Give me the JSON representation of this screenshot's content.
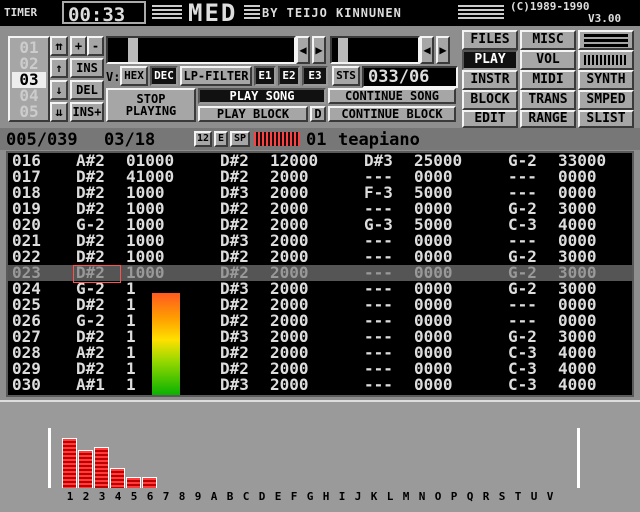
{
  "topbar": {
    "timer_label": "TIMER",
    "timer_value": "00:33",
    "logo": "MED",
    "author": "BY TEIJO KINNUNEN",
    "copyright": "(C)1989-1990",
    "version": "V3.00"
  },
  "tracks": {
    "numbers": [
      "01",
      "02",
      "03",
      "04",
      "05"
    ],
    "current": "03"
  },
  "side_buttons": {
    "ins": "INS",
    "del": "DEL",
    "ins_plus": "INS+",
    "plus": "+",
    "minus": "-"
  },
  "mode": {
    "v_label": "V:",
    "hex": "HEX",
    "dec": "DEC",
    "filter": "LP-FILTER",
    "e1": "E1",
    "e2": "E2",
    "e3": "E3",
    "sts": "STS",
    "sts_value": "033/06"
  },
  "play": {
    "stop": "STOP",
    "playing": "PLAYING",
    "play_song": "PLAY SONG",
    "play_block": "PLAY BLOCK",
    "d": "D",
    "continue_song": "CONTINUE SONG",
    "continue_block": "CONTINUE BLOCK"
  },
  "menu": {
    "files": "FILES",
    "misc": "MISC",
    "play": "PLAY",
    "vol": "VOL",
    "instr": "INSTR",
    "midi": "MIDI",
    "synth": "SYNTH",
    "block": "BLOCK",
    "trans": "TRANS",
    "smped": "SMPED",
    "edit": "EDIT",
    "range": "RANGE",
    "slist": "SLIST"
  },
  "status": {
    "block": "005/039",
    "position": "03/18",
    "num12": "12",
    "e": "E",
    "sp": "SP",
    "instr_num": "01",
    "instr_name": "teapiano"
  },
  "pattern_rows": [
    {
      "line": "016",
      "c1": "A#2",
      "v1": "01000",
      "c2": "D#2",
      "v2": "12000",
      "c3": "D#3",
      "v3": "25000",
      "c4": "G-2",
      "v4": "33000"
    },
    {
      "line": "017",
      "c1": "D#2",
      "v1": "41000",
      "c2": "D#2",
      "v2": "2000",
      "c3": "---",
      "v3": "0000",
      "c4": "---",
      "v4": "0000"
    },
    {
      "line": "018",
      "c1": "D#2",
      "v1": "1000",
      "c2": "D#3",
      "v2": "2000",
      "c3": "F-3",
      "v3": "5000",
      "c4": "---",
      "v4": "0000"
    },
    {
      "line": "019",
      "c1": "D#2",
      "v1": "1000",
      "c2": "D#2",
      "v2": "2000",
      "c3": "---",
      "v3": "0000",
      "c4": "G-2",
      "v4": "3000"
    },
    {
      "line": "020",
      "c1": "G-2",
      "v1": "1000",
      "c2": "D#2",
      "v2": "2000",
      "c3": "G-3",
      "v3": "5000",
      "c4": "C-3",
      "v4": "4000"
    },
    {
      "line": "021",
      "c1": "D#2",
      "v1": "1000",
      "c2": "D#3",
      "v2": "2000",
      "c3": "---",
      "v3": "0000",
      "c4": "---",
      "v4": "0000"
    },
    {
      "line": "022",
      "c1": "D#2",
      "v1": "1000",
      "c2": "D#2",
      "v2": "2000",
      "c3": "---",
      "v3": "0000",
      "c4": "G-2",
      "v4": "3000"
    },
    {
      "line": "023",
      "c1": "D#2",
      "v1": "1000",
      "c2": "D#2",
      "v2": "2000",
      "c3": "---",
      "v3": "0000",
      "c4": "G-2",
      "v4": "3000"
    },
    {
      "line": "024",
      "c1": "G-2",
      "v1": "1",
      "c2": "D#3",
      "v2": "2000",
      "c3": "---",
      "v3": "0000",
      "c4": "G-2",
      "v4": "3000"
    },
    {
      "line": "025",
      "c1": "D#2",
      "v1": "1",
      "c2": "D#2",
      "v2": "2000",
      "c3": "---",
      "v3": "0000",
      "c4": "---",
      "v4": "0000"
    },
    {
      "line": "026",
      "c1": "G-2",
      "v1": "1",
      "c2": "D#2",
      "v2": "2000",
      "c3": "---",
      "v3": "0000",
      "c4": "---",
      "v4": "0000"
    },
    {
      "line": "027",
      "c1": "D#2",
      "v1": "1",
      "c2": "D#3",
      "v2": "2000",
      "c3": "---",
      "v3": "0000",
      "c4": "G-2",
      "v4": "3000"
    },
    {
      "line": "028",
      "c1": "A#2",
      "v1": "1",
      "c2": "D#2",
      "v2": "2000",
      "c3": "---",
      "v3": "0000",
      "c4": "C-3",
      "v4": "4000"
    },
    {
      "line": "029",
      "c1": "D#2",
      "v1": "1",
      "c2": "D#2",
      "v2": "2000",
      "c3": "---",
      "v3": "0000",
      "c4": "C-3",
      "v4": "4000"
    },
    {
      "line": "030",
      "c1": "A#1",
      "v1": "1",
      "c2": "D#3",
      "v2": "2000",
      "c3": "---",
      "v3": "0000",
      "c4": "C-3",
      "v4": "4000"
    }
  ],
  "current_row": 7,
  "vu_level": 0.95,
  "spectrum": {
    "labels": [
      "1",
      "2",
      "3",
      "4",
      "5",
      "6",
      "7",
      "8",
      "9",
      "A",
      "B",
      "C",
      "D",
      "E",
      "F",
      "G",
      "H",
      "I",
      "J",
      "K",
      "L",
      "M",
      "N",
      "O",
      "P",
      "Q",
      "R",
      "S",
      "T",
      "U",
      "V"
    ],
    "levels": [
      0.83,
      0.63,
      0.69,
      0.34,
      0.19,
      0.19,
      0,
      0,
      0,
      0,
      0,
      0,
      0,
      0,
      0,
      0,
      0,
      0,
      0,
      0,
      0,
      0,
      0,
      0,
      0,
      0,
      0,
      0,
      0,
      0,
      0
    ]
  },
  "colors": {
    "accent_red": "#ff5050",
    "active_bg": "#111111"
  }
}
